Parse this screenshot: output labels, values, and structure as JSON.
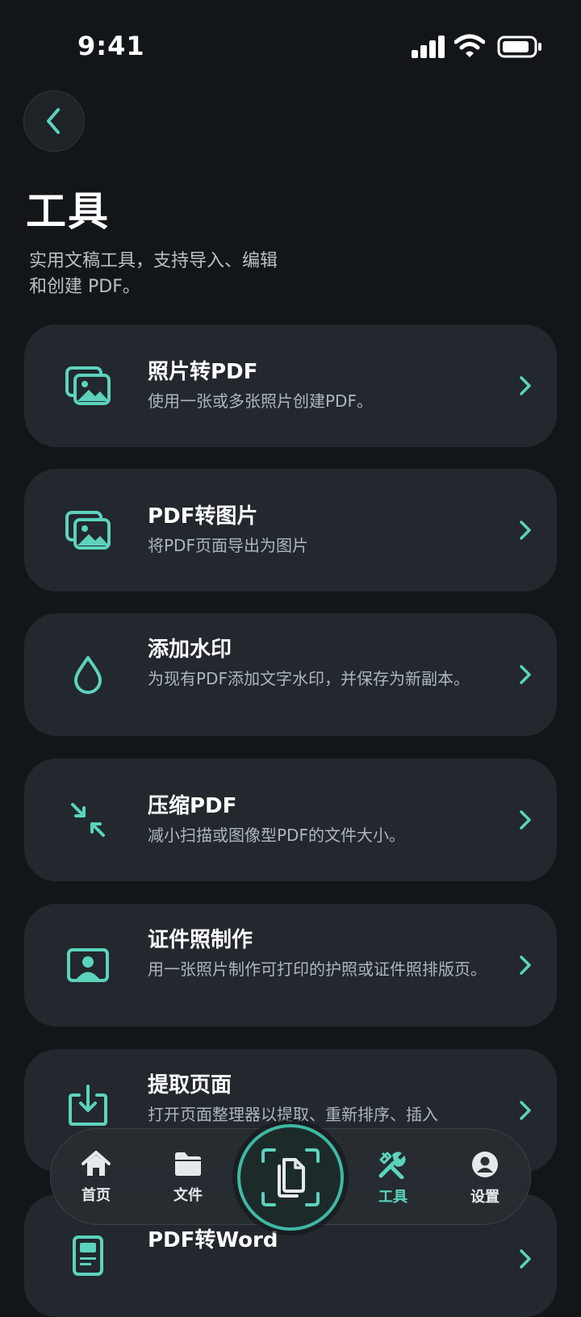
{
  "status_bar": {
    "time": "9:41"
  },
  "header": {
    "title": "工具",
    "subtitle": "实用文稿工具，支持导入、编辑和创建 PDF。"
  },
  "tools": [
    {
      "icon": "photos-icon",
      "title": "照片转PDF",
      "description": "使用一张或多张照片创建PDF。"
    },
    {
      "icon": "images-icon",
      "title": "PDF转图片",
      "description": "将PDF页面导出为图片"
    },
    {
      "icon": "droplet-icon",
      "title": "添加水印",
      "description": "为现有PDF添加文字水印，并保存为新副本。"
    },
    {
      "icon": "compress-icon",
      "title": "压缩PDF",
      "description": "减小扫描或图像型PDF的文件大小。"
    },
    {
      "icon": "id-photo-icon",
      "title": "证件照制作",
      "description": "用一张照片制作可打印的护照或证件照排版页。"
    },
    {
      "icon": "extract-icon",
      "title": "提取页面",
      "description": "打开页面整理器以提取、重新排序、插入"
    },
    {
      "icon": "word-icon",
      "title": "PDF转Word",
      "description": ""
    }
  ],
  "nav": {
    "items": [
      {
        "label": "首页",
        "icon": "home-icon"
      },
      {
        "label": "文件",
        "icon": "folder-icon"
      },
      {
        "label": "工具",
        "icon": "tools-icon",
        "active": true
      },
      {
        "label": "设置",
        "icon": "profile-icon"
      }
    ],
    "scan_icon": "scan-document-icon"
  },
  "colors": {
    "accent": "#5cd3bd",
    "background": "#131619",
    "card": "#22282d"
  }
}
